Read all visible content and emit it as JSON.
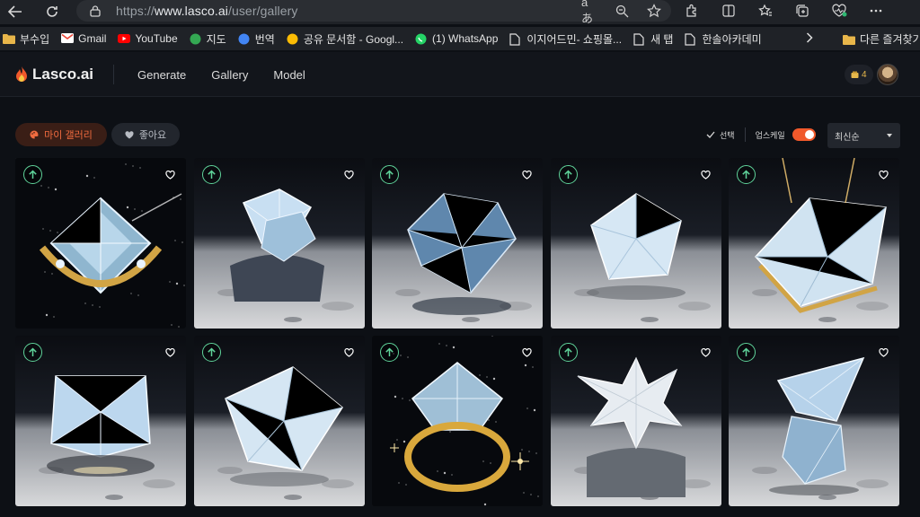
{
  "browser": {
    "url_prefix": "https://",
    "url_host": "www.lasco.ai",
    "url_path": "/user/gallery",
    "reader_label": "aあ"
  },
  "bookmarks": [
    {
      "label": "부수입",
      "icon": "folder-icon",
      "color": "#e8b64a"
    },
    {
      "label": "Gmail",
      "icon": "gmail-icon",
      "color": "#ea4335"
    },
    {
      "label": "YouTube",
      "icon": "youtube-icon",
      "color": "#ff0000"
    },
    {
      "label": "지도",
      "icon": "maps-icon",
      "color": "#34a853"
    },
    {
      "label": "번역",
      "icon": "translate-icon",
      "color": "#4285f4"
    },
    {
      "label": "공유 문서함 - Googl...",
      "icon": "drive-icon",
      "color": "#fbbc04"
    },
    {
      "label": "(1) WhatsApp",
      "icon": "whatsapp-icon",
      "color": "#25d366"
    },
    {
      "label": "이지어드민- 쇼핑몰...",
      "icon": "page-icon",
      "color": "#e0e0e0"
    },
    {
      "label": "새 탭",
      "icon": "page-icon",
      "color": "#e0e0e0"
    },
    {
      "label": "한솔아카데미",
      "icon": "page-icon",
      "color": "#e0e0e0"
    }
  ],
  "bookmarks_other": "다른 즐겨찾기",
  "app": {
    "logo_text": "Lasco.ai",
    "nav": [
      "Generate",
      "Gallery",
      "Model"
    ],
    "credits": "4"
  },
  "filters": {
    "my_gallery": "마이 갤러리",
    "likes": "좋아요",
    "select_label": "선택",
    "upscale_label": "업스케일",
    "upscale_on": true,
    "sort_value": "최신순"
  },
  "gallery": [
    {
      "subject": "diamond ring gold",
      "bg": "space"
    },
    {
      "subject": "diamond on rock",
      "bg": "moon"
    },
    {
      "subject": "blue diamond",
      "bg": "moon"
    },
    {
      "subject": "pentagon diamond",
      "bg": "moon"
    },
    {
      "subject": "diamond gold setting",
      "bg": "moon"
    },
    {
      "subject": "cube diamond",
      "bg": "moon"
    },
    {
      "subject": "faceted diamond",
      "bg": "moon"
    },
    {
      "subject": "diamond gold ring",
      "bg": "space"
    },
    {
      "subject": "star diamond on rock",
      "bg": "moon"
    },
    {
      "subject": "tall crystal",
      "bg": "moon"
    }
  ]
}
